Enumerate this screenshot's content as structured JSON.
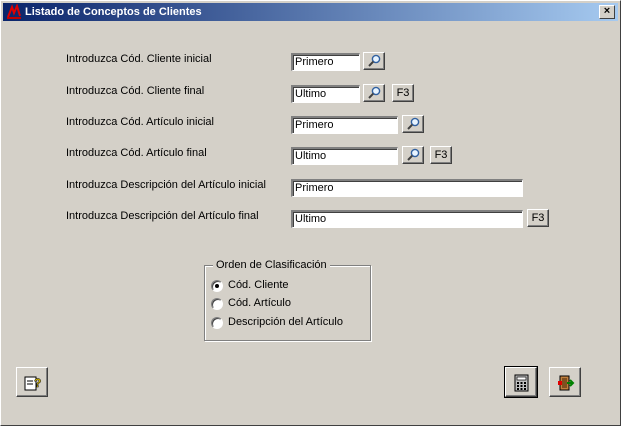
{
  "window": {
    "title": "Listado de Conceptos de Clientes",
    "close_label": "×"
  },
  "fields": [
    {
      "label": "Introduzca Cód. Cliente inicial",
      "value": "Primero",
      "search": true,
      "f3": false
    },
    {
      "label": "Introduzca Cód. Cliente final",
      "value": "Ultimo",
      "search": true,
      "f3": true
    },
    {
      "label": "Introduzca Cód. Artículo inicial",
      "value": "Primero",
      "search": true,
      "f3": false
    },
    {
      "label": "Introduzca Cód. Artículo final",
      "value": "Ultimo",
      "search": true,
      "f3": true
    },
    {
      "label": "Introduzca Descripción del Artículo inicial",
      "value": "Primero",
      "search": false,
      "f3": false
    },
    {
      "label": "Introduzca Descripción del Artículo final",
      "value": "Ultimo",
      "search": false,
      "f3": true
    }
  ],
  "f3_label": "F3",
  "sort": {
    "title": "Orden de Clasificación",
    "options": [
      {
        "label": "Cód. Cliente",
        "selected": true
      },
      {
        "label": "Cód. Artículo",
        "selected": false
      },
      {
        "label": "Descripción del Artículo",
        "selected": false
      }
    ]
  },
  "icons": {
    "search": "magnifier-icon",
    "help": "help-icon",
    "print": "calculator-print-icon",
    "exit": "exit-door-icon"
  },
  "colors": {
    "titlebar_start": "#0a246a",
    "titlebar_end": "#a6caf0",
    "face": "#d4d0c8"
  }
}
